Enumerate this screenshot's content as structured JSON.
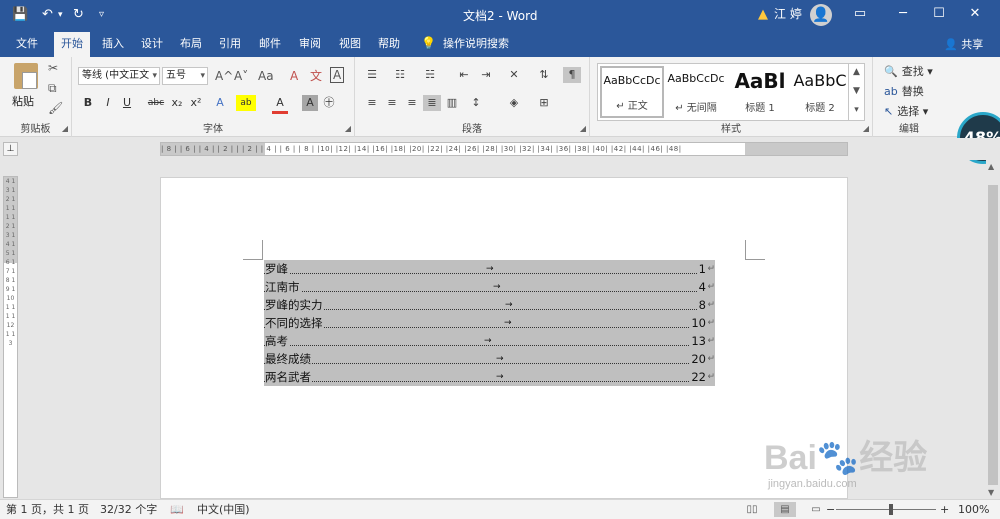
{
  "titlebar": {
    "title": "文档2 - Word",
    "user": "江 婷",
    "save_icon": "💾",
    "undo_icon": "↶",
    "redo_icon": "↻",
    "customize_icon": "▿",
    "warning_icon": "▲",
    "avatar_icon": "👤",
    "ribbon_options_icon": "▭",
    "minimize": "─",
    "maximize": "☐",
    "close": "✕"
  },
  "tabs": [
    {
      "label": "文件"
    },
    {
      "label": "开始"
    },
    {
      "label": "插入"
    },
    {
      "label": "设计"
    },
    {
      "label": "布局"
    },
    {
      "label": "引用"
    },
    {
      "label": "邮件"
    },
    {
      "label": "审阅"
    },
    {
      "label": "视图"
    },
    {
      "label": "帮助"
    },
    {
      "label": "操作说明搜索"
    }
  ],
  "share": "共享",
  "ribbon": {
    "clipboard": {
      "paste": "粘贴",
      "label": "剪贴板"
    },
    "font": {
      "font_name": "等线 (中文正文",
      "font_size": "五号",
      "grow": "A^",
      "shrink": "A˅",
      "case": "Aa",
      "clear": "A",
      "phonetic": "文",
      "border": "A",
      "bold": "B",
      "italic": "I",
      "underline": "U",
      "strike": "abc",
      "sub": "x₂",
      "sup": "x²",
      "effects": "A",
      "highlight": "ab",
      "color": "A",
      "shade": "A",
      "enclose": "㊉",
      "label": "字体"
    },
    "paragraph": {
      "label": "段落"
    },
    "styles": {
      "items": [
        {
          "sample": "AaBbCcDc",
          "name": "↵ 正文"
        },
        {
          "sample": "AaBbCcDc",
          "name": "↵ 无间隔"
        },
        {
          "sample": "AaBl",
          "name": "标题 1"
        },
        {
          "sample": "AaBbC",
          "name": "标题 2"
        }
      ],
      "label": "样式"
    },
    "editing": {
      "find": "查找",
      "replace": "替换",
      "select": "选择",
      "label": "编辑"
    }
  },
  "badge_percent": "48%",
  "ruler": {
    "corner": "⊥",
    "h_numbers": "| 8 |  | 6 |  | 4 |  | 2 |   |   | 2 |  | 4 |  | 6 |  | 8 |  |10|  |12|  |14|  |16|  |18|  |20|  |22|  |24|  |26|  |28|  |30|  |32|  |34|  |36|  |38|  |40|  |42|  |44|  |46|  |48|",
    "v_numbers": "4 1 3 1 2 1 1 1 1 1 2 1 3 1 4 1 5 1 6 1 7 1 8 1 9 1 10 1 11 1 12 1 13"
  },
  "toc": [
    {
      "title": "罗峰",
      "page": "1"
    },
    {
      "title": "江南市",
      "page": "4"
    },
    {
      "title": "罗峰的实力",
      "page": "8"
    },
    {
      "title": "不同的选择",
      "page": "10"
    },
    {
      "title": "高考",
      "page": "13"
    },
    {
      "title": "最终成绩",
      "page": "20"
    },
    {
      "title": "两名武者",
      "page": "22"
    }
  ],
  "toc_arrow": "→",
  "toc_mark": "↵",
  "status": {
    "page": "第 1 页，共 1 页",
    "words": "32/32 个字",
    "proof_icon": "📖",
    "language": "中文(中国)",
    "zoom_out": "−",
    "zoom_in": "+",
    "zoom": "100%"
  },
  "watermark": {
    "text": "Bai🐾经验",
    "sub": "jingyan.baidu.com"
  }
}
